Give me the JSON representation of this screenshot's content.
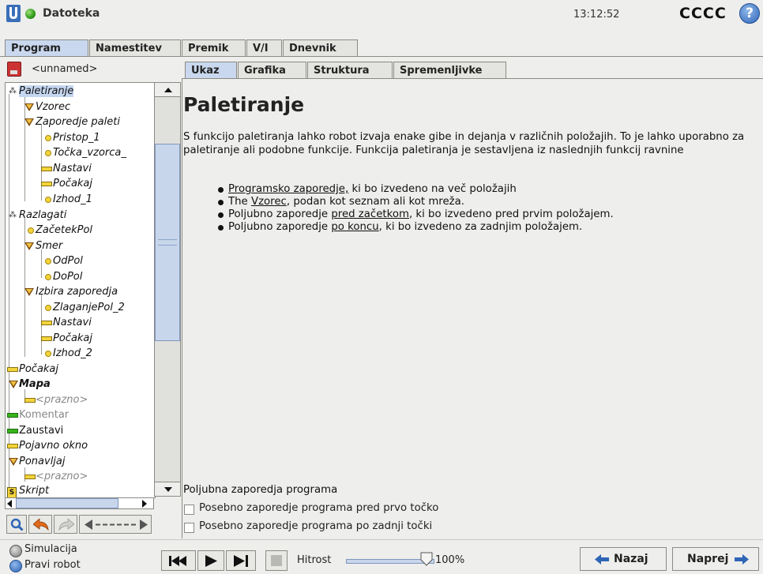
{
  "header": {
    "file_label": "Datoteka",
    "clock": "13:12:52",
    "robot_name": "CCCC",
    "help_label": "?"
  },
  "main_tabs": [
    "Program",
    "Namestitev",
    "Premik",
    "V/I",
    "Dnevnik"
  ],
  "program": {
    "filename": "<unnamed>"
  },
  "tree": [
    {
      "label": "Paletiranje"
    },
    {
      "label": "Vzorec"
    },
    {
      "label": "Zaporedje paleti"
    },
    {
      "label": "Pristop_1"
    },
    {
      "label": "Točka_vzorca_"
    },
    {
      "label": "Nastavi"
    },
    {
      "label": "Počakaj"
    },
    {
      "label": "Izhod_1"
    },
    {
      "label": "Razlagati"
    },
    {
      "label": "ZačetekPol"
    },
    {
      "label": "Smer"
    },
    {
      "label": "OdPol"
    },
    {
      "label": "DoPol"
    },
    {
      "label": "Izbira zaporedja"
    },
    {
      "label": "ZlaganjePol_2"
    },
    {
      "label": "Nastavi"
    },
    {
      "label": "Počakaj"
    },
    {
      "label": "Izhod_2"
    },
    {
      "label": "Počakaj"
    },
    {
      "label": "Mapa"
    },
    {
      "label": "<prazno>"
    },
    {
      "label": "Komentar"
    },
    {
      "label": "Zaustavi"
    },
    {
      "label": "Pojavno okno"
    },
    {
      "label": "Ponavljaj"
    },
    {
      "label": "<prazno>"
    },
    {
      "label": "Skript"
    }
  ],
  "content_tabs": [
    "Ukaz",
    "Grafika",
    "Struktura",
    "Spremenljivke"
  ],
  "content": {
    "title": "Paletiranje",
    "description": "S funkcijo paletiranja lahko robot izvaja enake gibe in dejanja v različnih položajih. To je lahko uporabno za paletiranje ali podobne funkcije. Funkcija paletiranja je sestavljena iz naslednjih funkcij ravnine",
    "bullets": [
      {
        "pre": "",
        "link": "Programsko zaporedje,",
        "post": " ki bo izvedeno na več položajih"
      },
      {
        "pre": "The ",
        "link": "Vzorec",
        "post": ", podan kot seznam ali kot mreža."
      },
      {
        "pre": "Poljubno zaporedje ",
        "link": "pred začetkom",
        "post": ", ki bo izvedeno pred prvim položajem."
      },
      {
        "pre": "Poljubno zaporedje ",
        "link": "po koncu",
        "post": ", ki bo izvedeno za zadnjim položajem."
      }
    ],
    "options_title": "Poljubna zaporedja programa",
    "option_before": "Posebno zaporedje programa pred prvo točko",
    "option_after": "Posebno zaporedje programa po zadnji točki"
  },
  "footer": {
    "simulation_label": "Simulacija",
    "real_robot_label": "Pravi robot",
    "speed_label": "Hitrost",
    "speed_value": "100%",
    "speed_fraction": 1.0,
    "back_label": "Nazaj",
    "next_label": "Naprej"
  },
  "colors": {
    "accent_tab": "#c9d8ee",
    "status_green": "#2e9a1a",
    "help_blue": "#2f65b7",
    "nav_arrow": "#2f65b7"
  }
}
